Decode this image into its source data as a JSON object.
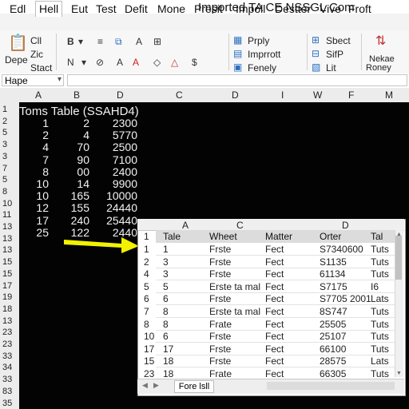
{
  "window": {
    "title": "Imported TA CE NSSGL Com"
  },
  "menu": [
    "Edl",
    "Hell",
    "Eut",
    "Test",
    "Defit",
    "Mone",
    "Presit",
    "Impoll",
    "Destter",
    "Vive",
    "Froft"
  ],
  "ribbon": {
    "clipboard": [
      "Cll",
      "Zic",
      "Stact"
    ],
    "paste": "Depe",
    "formatting": [
      "Prply",
      "Imprrott",
      "Fenely"
    ],
    "cells": [
      "Sbect",
      "SifP",
      "Lit"
    ],
    "sort": [
      "Nekae",
      "Roney"
    ]
  },
  "formula_bar": {
    "name_box": "Hape"
  },
  "sheet": {
    "columns": [
      "A",
      "B",
      "D",
      "C",
      "D",
      "I",
      "W",
      "F",
      "M"
    ],
    "rows": [
      "1",
      "2",
      "5",
      "3",
      "3",
      "7",
      "5",
      "8",
      "10",
      "11",
      "13",
      "13",
      "13",
      "15",
      "15",
      "17",
      "19",
      "18",
      "13",
      "23",
      "23",
      "33",
      "34",
      "33",
      "83",
      "35"
    ],
    "title": "Toms Table (SSAHD4)",
    "data": [
      [
        "1",
        "2",
        "2300"
      ],
      [
        "2",
        "4",
        "5770"
      ],
      [
        "4",
        "70",
        "2500"
      ],
      [
        "7",
        "90",
        "7100"
      ],
      [
        "8",
        "00",
        "2400"
      ],
      [
        "10",
        "14",
        "9900"
      ],
      [
        "10",
        "165",
        "10000"
      ],
      [
        "12",
        "155",
        "24440"
      ],
      [
        "17",
        "240",
        "25440"
      ],
      [
        "25",
        "122",
        "2440"
      ]
    ]
  },
  "dialog": {
    "columns": [
      "A",
      "C",
      "D"
    ],
    "headers": [
      "1",
      "Tale",
      "Wheet",
      "Matter",
      "Orter",
      "Tal"
    ],
    "rows": [
      [
        "1",
        "1",
        "Frste",
        "Fect",
        "S7340600",
        "Tuts"
      ],
      [
        "2",
        "3",
        "Frste",
        "Fect",
        "S1135",
        "Tuts"
      ],
      [
        "4",
        "3",
        "Frste",
        "Fect",
        "61134",
        "Tuts"
      ],
      [
        "5",
        "5",
        "Erste ta mal",
        "Fect",
        "S7175",
        "I6"
      ],
      [
        "6",
        "6",
        "Frste",
        "Fect",
        "S7705 2001",
        "Lats"
      ],
      [
        "7",
        "8",
        "Erste ta mal",
        "Fect",
        "8S747",
        "Tuts"
      ],
      [
        "8",
        "8",
        "Frate",
        "Fect",
        "25505",
        "Tuts"
      ],
      [
        "10",
        "6",
        "Frste",
        "Fect",
        "25107",
        "Tuts"
      ],
      [
        "17",
        "17",
        "Frste",
        "Fect",
        "66100",
        "Tuts"
      ],
      [
        "15",
        "18",
        "Frste",
        "Fect",
        "28575",
        "Lats"
      ],
      [
        "23",
        "18",
        "Frate",
        "Fect",
        "66305",
        "Tuts"
      ]
    ],
    "sheet_tab": "Fore  lsll"
  },
  "colors": {
    "sheet_background": "#030303",
    "arrow": "#f2f200",
    "header_gray": "#dcdcdc"
  }
}
